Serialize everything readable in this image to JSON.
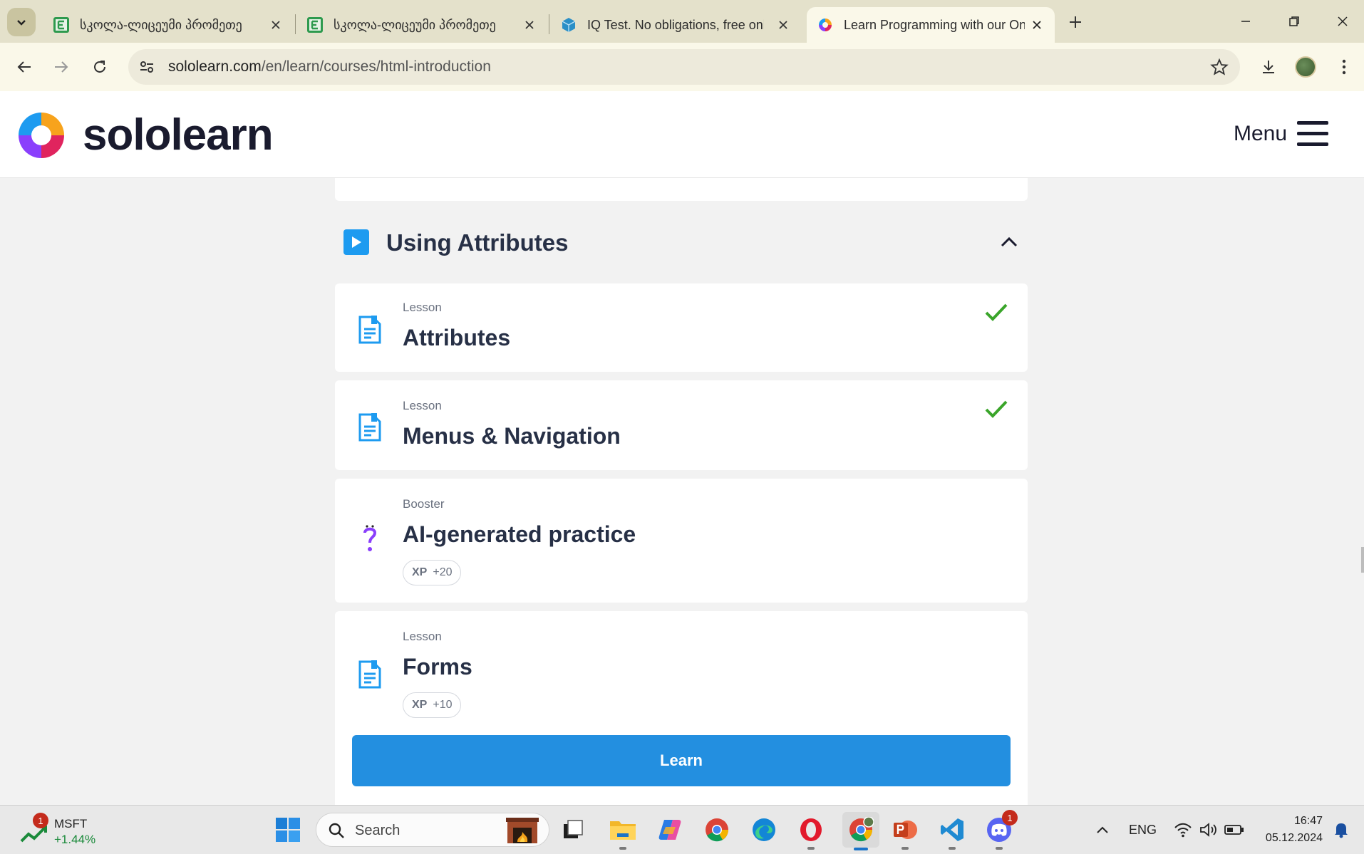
{
  "browser": {
    "tabs": [
      {
        "title": "სკოლა-ლიცეუმი პრომეთე",
        "favicon": "green-e-icon",
        "active": false
      },
      {
        "title": "სკოლა-ლიცეუმი პრომეთე",
        "favicon": "green-e-icon",
        "active": false
      },
      {
        "title": "IQ Test. No obligations, free onl",
        "favicon": "blue-cube-icon",
        "active": false
      },
      {
        "title": "Learn Programming with our Onl",
        "favicon": "sololearn-icon",
        "active": true
      }
    ],
    "url_host": "sololearn.com",
    "url_path": "/en/learn/courses/html-introduction",
    "accent": "#e4e1cb"
  },
  "site": {
    "brand": "sololearn",
    "menu_label": "Menu"
  },
  "section": {
    "title": "Using Attributes"
  },
  "items": [
    {
      "kind": "Lesson",
      "title": "Attributes",
      "completed": true,
      "xp": null,
      "icon": "lesson-doc-icon"
    },
    {
      "kind": "Lesson",
      "title": "Menus & Navigation",
      "completed": true,
      "xp": null,
      "icon": "lesson-doc-icon"
    },
    {
      "kind": "Booster",
      "title": "AI-generated practice",
      "completed": false,
      "xp_label": "XP",
      "xp_value": "+20",
      "icon": "question-mark-icon"
    },
    {
      "kind": "Lesson",
      "title": "Forms",
      "completed": false,
      "xp_label": "XP",
      "xp_value": "+10",
      "icon": "lesson-doc-icon"
    }
  ],
  "cta": {
    "label": "Learn"
  },
  "taskbar": {
    "widget_ticker": "MSFT",
    "widget_change": "+1.44%",
    "widget_badge": "1",
    "search_placeholder": "Search",
    "language": "ENG",
    "time": "16:47",
    "date": "05.12.2024",
    "discord_badge": "1"
  },
  "colors": {
    "primary_blue": "#238fe0",
    "check_green": "#3aa52a",
    "title_navy": "#273046"
  }
}
